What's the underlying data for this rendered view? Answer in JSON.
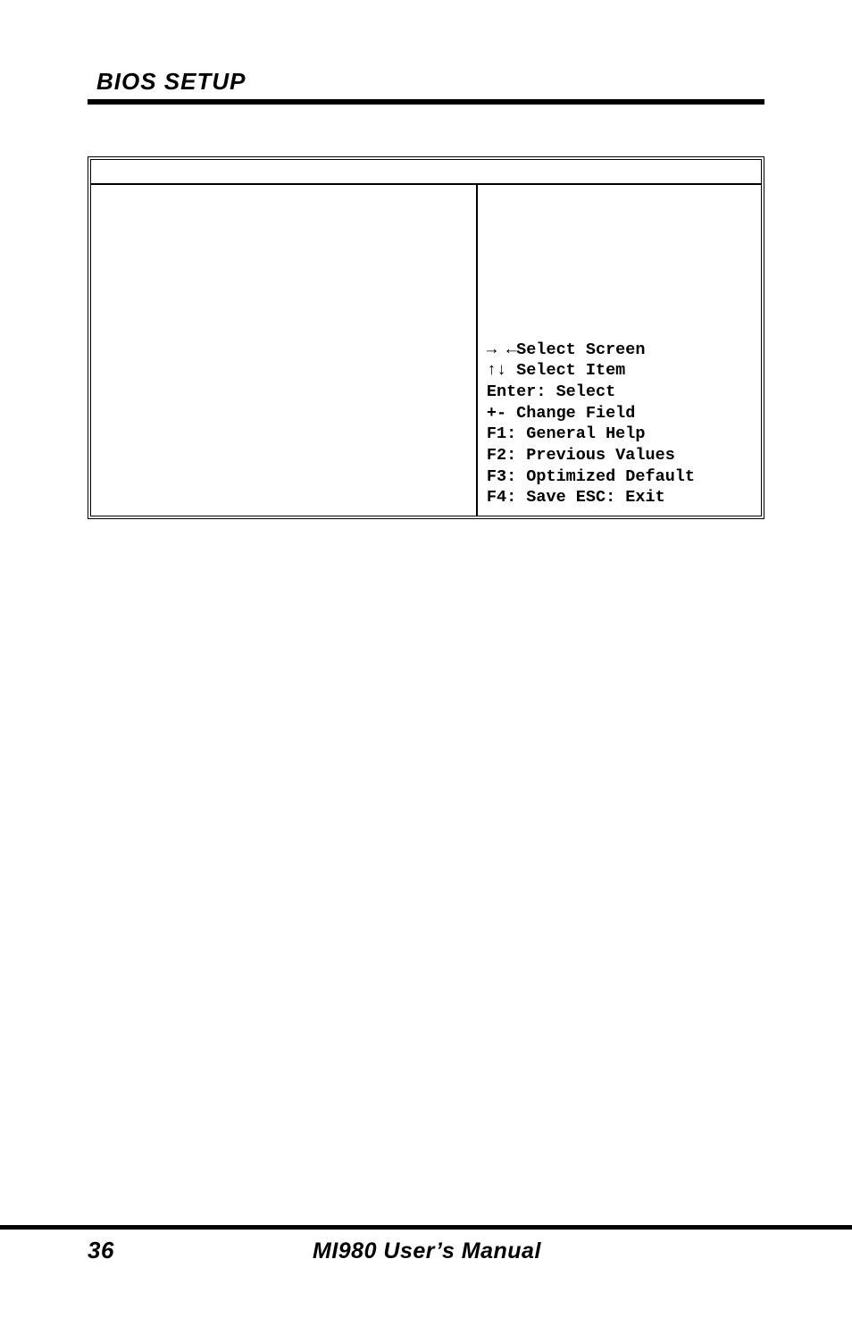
{
  "header": {
    "title": "BIOS SETUP"
  },
  "bios": {
    "help": {
      "select_screen": "→ ←Select Screen",
      "select_item": "↑↓ Select Item",
      "enter": "Enter: Select",
      "change_field": "+-  Change Field",
      "general_help": "F1: General Help",
      "prev_values": "F2: Previous Values",
      "opt_default": "F3: Optimized Default",
      "save_exit": "F4: Save  ESC: Exit"
    }
  },
  "footer": {
    "page_num": "36",
    "manual_title": "MI980 User’s Manual"
  }
}
